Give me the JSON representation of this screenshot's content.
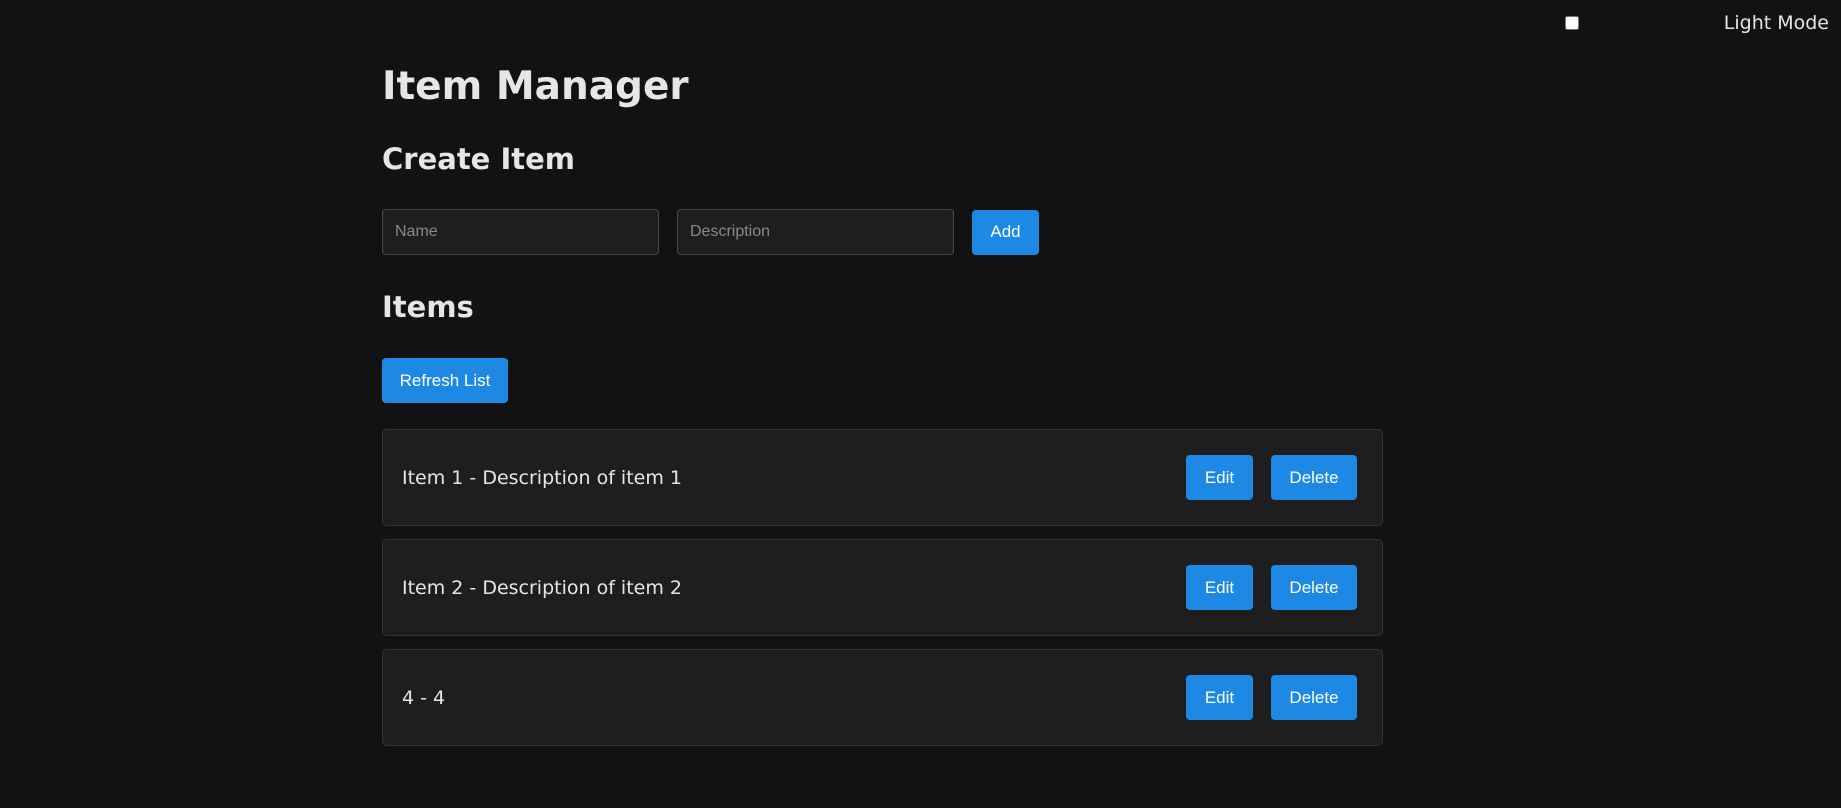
{
  "theme_toggle": {
    "label": "Light Mode",
    "checked": false
  },
  "page": {
    "title": "Item Manager"
  },
  "create": {
    "heading": "Create Item",
    "name_placeholder": "Name",
    "description_placeholder": "Description",
    "add_label": "Add"
  },
  "items_section": {
    "heading": "Items",
    "refresh_label": "Refresh List"
  },
  "items": [
    {
      "text": "Item 1 - Description of item 1",
      "edit_label": "Edit",
      "delete_label": "Delete"
    },
    {
      "text": "Item 2 - Description of item 2",
      "edit_label": "Edit",
      "delete_label": "Delete"
    },
    {
      "text": "4 - 4",
      "edit_label": "Edit",
      "delete_label": "Delete"
    }
  ],
  "colors": {
    "background": "#121212",
    "surface": "#1e1e1e",
    "accent": "#1e88e5",
    "text": "#e6e6e6"
  }
}
